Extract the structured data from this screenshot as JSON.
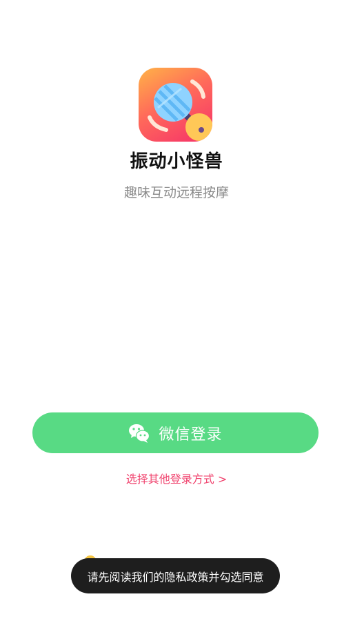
{
  "app": {
    "name": "振动小怪兽",
    "slogan": "趣味互动远程按摩"
  },
  "login": {
    "wechat_label": "微信登录",
    "other_label": "选择其他登录方式 >"
  },
  "toast": {
    "message": "请先阅读我们的隐私政策并勾选同意"
  },
  "colors": {
    "wechat_button": "#58da84",
    "link": "#f0436e",
    "toast_bg": "#1e1e1e"
  },
  "icons": {
    "logo": "app-logo-icon",
    "wechat": "wechat-icon"
  }
}
